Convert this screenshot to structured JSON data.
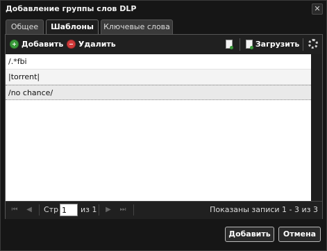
{
  "window": {
    "title": "Добавление группы слов DLP",
    "close_label": "✕"
  },
  "tabs": [
    {
      "label": "Общее"
    },
    {
      "label": "Шаблоны"
    },
    {
      "label": "Ключевые слова"
    }
  ],
  "toolbar": {
    "add_label": "Добавить",
    "delete_label": "Удалить",
    "upload_label": "Загрузить"
  },
  "list": {
    "rows": [
      "/.*fbi",
      "|torrent|",
      "/no chance/"
    ]
  },
  "pager": {
    "page_label": "Стр",
    "page_value": "1",
    "of_label": "из 1",
    "info": "Показаны записи 1 - 3 из 3"
  },
  "buttons": {
    "add": "Добавить",
    "cancel": "Отмена"
  }
}
